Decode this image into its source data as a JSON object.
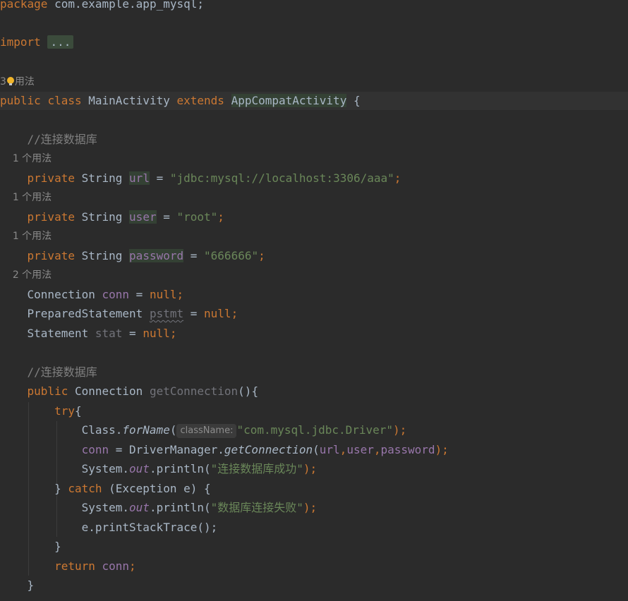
{
  "code": {
    "package_kw": "package",
    "package_name": "com.example.app_mysql;",
    "import_kw": "import",
    "import_fold": "...",
    "class_usages": {
      "count": "3",
      "label": "用法"
    },
    "class_decl": {
      "public_kw": "public",
      "class_kw": "class",
      "class_name": "MainActivity",
      "extends_kw": "extends",
      "super_class": "AppCompatActivity",
      "brace": "{"
    },
    "comment_connect_1": "//连接数据库",
    "url_usages": "1 个用法",
    "url_field": {
      "modifier": "private",
      "type": "String",
      "name": "url",
      "op": "=",
      "value": "\"jdbc:mysql://localhost:3306/aaa\"",
      "end": ";"
    },
    "user_usages": "1 个用法",
    "user_field": {
      "modifier": "private",
      "type": "String",
      "name": "user",
      "op": "=",
      "value": "\"root\"",
      "end": ";"
    },
    "password_usages": "1 个用法",
    "password_field": {
      "modifier": "private",
      "type": "String",
      "name": "password",
      "op": "=",
      "value": "\"666666\"",
      "end": ";"
    },
    "conn_usages": "2 个用法",
    "conn_field": {
      "type": "Connection",
      "name": "conn",
      "op": "=",
      "value": "null",
      "end": ";"
    },
    "pstmt_field": {
      "type": "PreparedStatement",
      "name": "pstmt",
      "op": "=",
      "value": "null",
      "end": ";"
    },
    "stat_field": {
      "type": "Statement",
      "name": "stat",
      "op": "=",
      "value": "null",
      "end": ";"
    },
    "comment_connect_2": "//连接数据库",
    "method_decl": {
      "modifier": "public",
      "return_type": "Connection",
      "name": "getConnection",
      "tail": "(){"
    },
    "try_kw": "try",
    "try_brace": "{",
    "forname_line": {
      "target": "Class.",
      "method": "forName",
      "open": "(",
      "param_hint": "className:",
      "arg": "\"com.mysql.jdbc.Driver\"",
      "close": ");"
    },
    "getconn_line": {
      "lhs": "conn",
      "op": " = ",
      "target": "DriverManager.",
      "method": "getConnection",
      "open": "(",
      "arg1": "url",
      "comma1": ",",
      "arg2": "user",
      "comma2": ",",
      "arg3": "password",
      "close": ");"
    },
    "println_success": {
      "target": "System.",
      "field": "out",
      "call": ".println(",
      "arg": "\"连接数据库成功\"",
      "close": ");"
    },
    "catch_line": {
      "close_brace": "} ",
      "catch_kw": "catch",
      "params": " (Exception e) {"
    },
    "println_fail": {
      "target": "System.",
      "field": "out",
      "call": ".println(",
      "arg": "\"数据库连接失败\"",
      "close": ");"
    },
    "print_stack": "e.printStackTrace();",
    "close_catch": "}",
    "return_line": {
      "kw": "return",
      "value": "conn",
      "end": ";"
    },
    "close_method": "}"
  },
  "colors": {
    "background": "#2b2b2b",
    "current_line": "#323232",
    "default_text": "#a9b7c6",
    "keyword": "#cc7832",
    "string": "#6a8759",
    "comment": "#808080",
    "field": "#9876aa",
    "inlay_hint": "#8a8a8a",
    "unused": "#72737a"
  }
}
